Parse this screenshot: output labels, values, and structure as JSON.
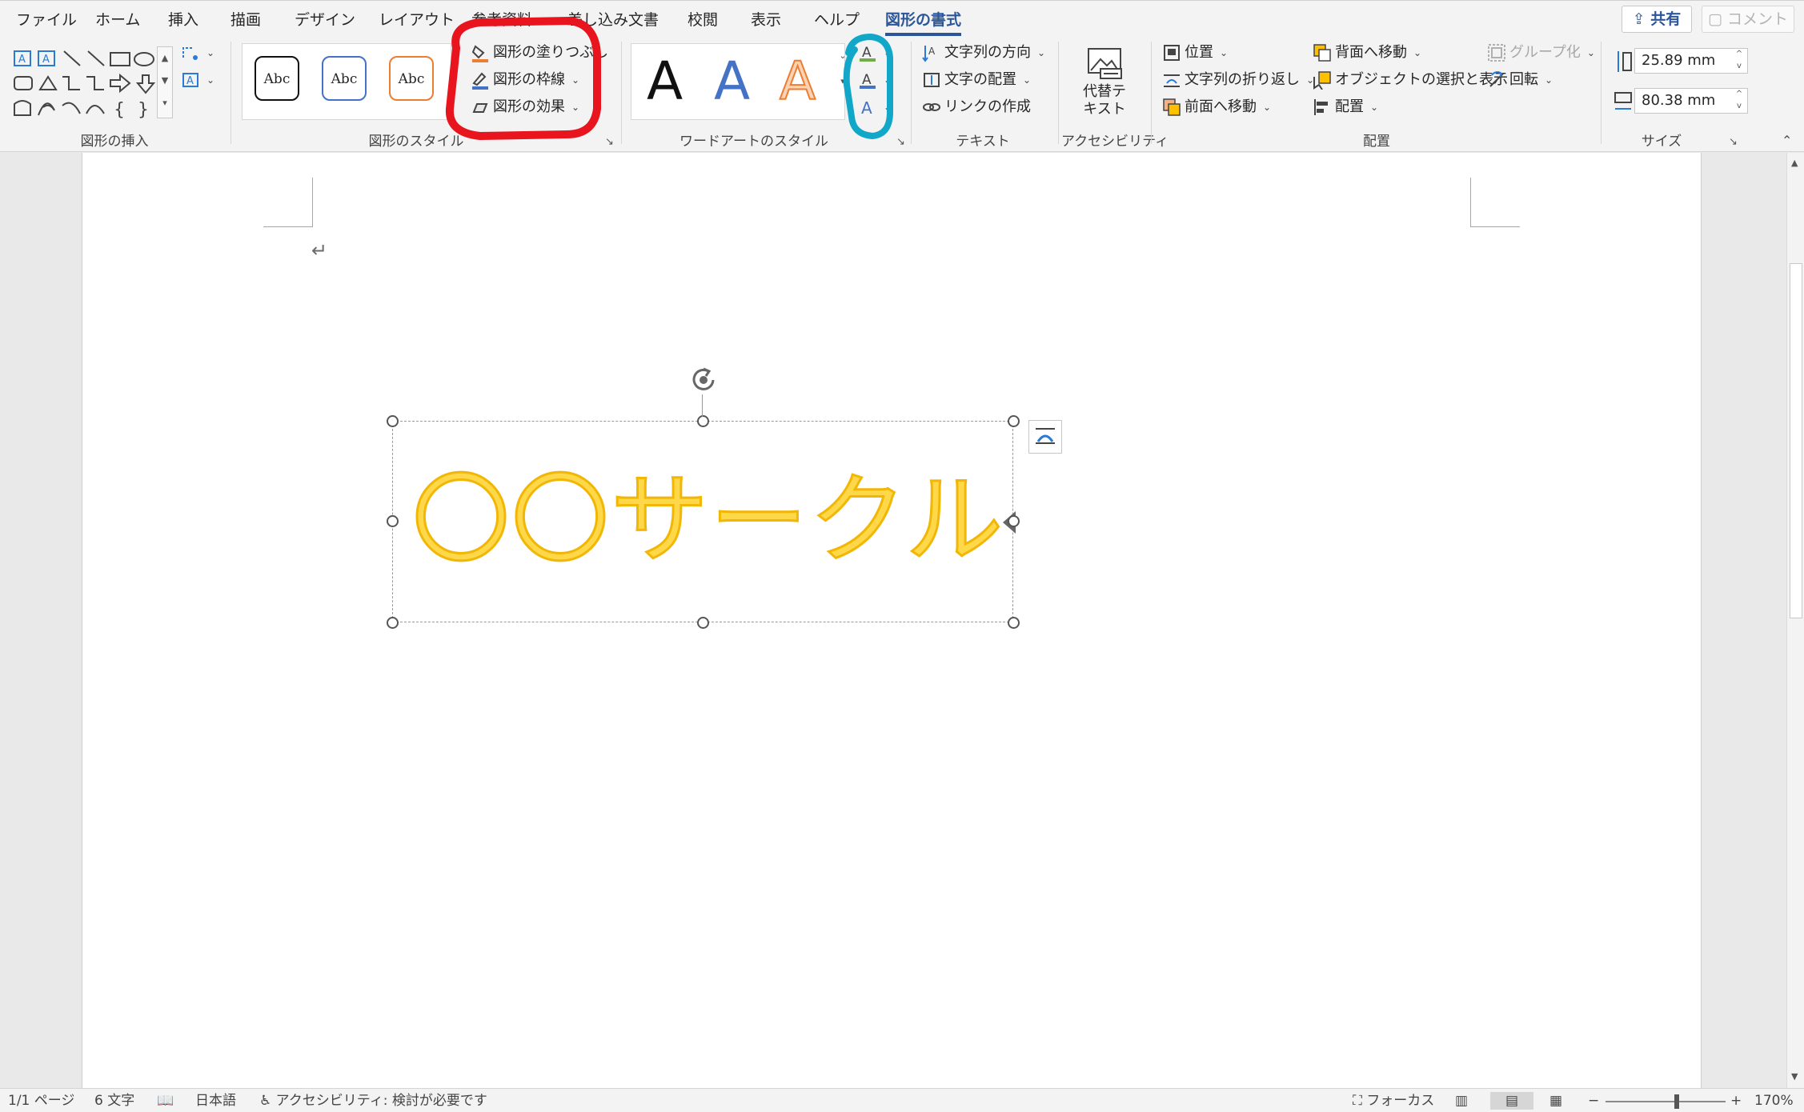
{
  "tabs": [
    {
      "label": "ファイル"
    },
    {
      "label": "ホーム"
    },
    {
      "label": "挿入"
    },
    {
      "label": "描画"
    },
    {
      "label": "デザイン"
    },
    {
      "label": "レイアウト"
    },
    {
      "label": "参考資料"
    },
    {
      "label": "差し込み文書"
    },
    {
      "label": "校閲"
    },
    {
      "label": "表示"
    },
    {
      "label": "ヘルプ"
    },
    {
      "label": "図形の書式"
    }
  ],
  "top_right": {
    "share": "共有",
    "comment": "コメント"
  },
  "ribbon": {
    "insert_shapes": {
      "label": "図形の挿入"
    },
    "shape_styles": {
      "label": "図形のスタイル",
      "preset": "Abc",
      "fill": "図形の塗りつぶし",
      "outline": "図形の枠線",
      "effects": "図形の効果"
    },
    "wordart": {
      "label": "ワードアートのスタイル",
      "letter": "A"
    },
    "text": {
      "label": "テキスト",
      "direction": "文字列の方向",
      "align": "文字の配置",
      "link": "リンクの作成"
    },
    "accessibility": {
      "label": "アクセシビリティ",
      "alt_text_line1": "代替テ",
      "alt_text_line2": "キスト"
    },
    "arrange": {
      "label": "配置",
      "position": "位置",
      "wrap": "文字列の折り返し",
      "forward": "前面へ移動",
      "backward": "背面へ移動",
      "selection_pane": "オブジェクトの選択と表示",
      "align": "配置",
      "group": "グループ化",
      "rotate": "回転"
    },
    "size": {
      "label": "サイズ",
      "height": "25.89 mm",
      "width": "80.38 mm"
    }
  },
  "document": {
    "wordart_text": "〇〇サークル",
    "paragraph_mark": "↵"
  },
  "status": {
    "page": "1/1 ページ",
    "words": "6 文字",
    "language": "日本語",
    "accessibility": "アクセシビリティ: 検討が必要です",
    "focus": "フォーカス",
    "zoom": "170%"
  },
  "colors": {
    "accent": "#2b579a",
    "wordart_fill": "#ffd84a",
    "wordart_outline": "#f2b705",
    "annotation_red": "#e8141e",
    "annotation_blue": "#12a7c8"
  }
}
